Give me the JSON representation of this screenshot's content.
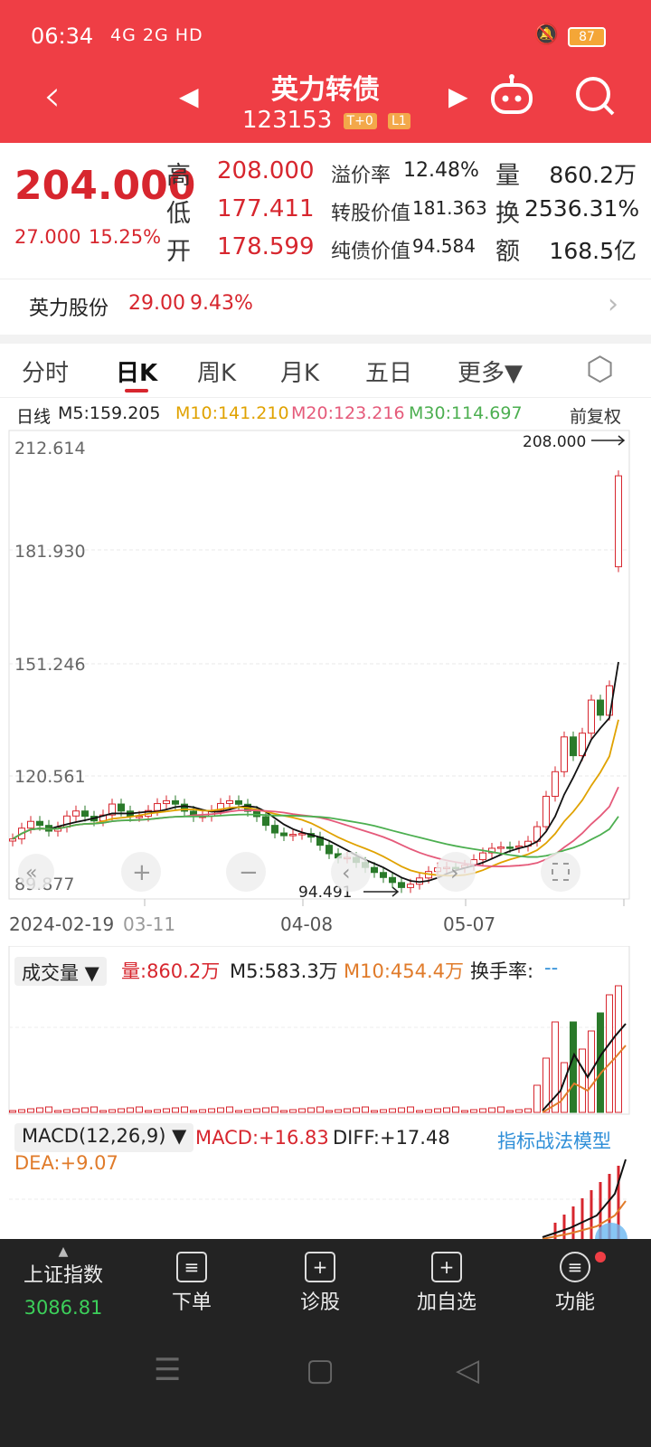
{
  "status": {
    "time": "06:34",
    "signals": "4G 2G HD",
    "battery": "87"
  },
  "header": {
    "title": "英力转债",
    "code": "123153",
    "tag1": "T+0",
    "tag2": "L1"
  },
  "quote": {
    "price": "204.000",
    "change": "27.000",
    "change_pct": "15.25%",
    "high_label": "高",
    "high": "208.000",
    "low_label": "低",
    "low": "177.411",
    "open_label": "开",
    "open": "178.599",
    "premium_label": "溢价率",
    "premium": "12.48%",
    "conv_label": "转股价值",
    "conv": "181.363",
    "bond_label": "纯债价值",
    "bond": "94.584",
    "vol_label": "量",
    "vol": "860.2万",
    "turn_label": "换",
    "turn": "2536.31%",
    "amt_label": "额",
    "amt": "168.5亿"
  },
  "stock": {
    "name": "英力股份",
    "price": "29.00",
    "pct": "9.43%"
  },
  "tabs": [
    "分时",
    "日K",
    "周K",
    "月K",
    "五日",
    "更多▼"
  ],
  "ma_legend": {
    "label": "日线",
    "m5": "M5:159.205",
    "m10": "M10:141.210",
    "m20": "M20:123.216",
    "m30": "M30:114.697",
    "adj": "前复权"
  },
  "price_axis": {
    "labels": [
      "212.614",
      "181.930",
      "151.246",
      "120.561",
      "89.877"
    ],
    "high_mark": "208.000",
    "low_mark": "94.491"
  },
  "x_axis": [
    "2024-02-19",
    "03-11",
    "04-08",
    "05-07"
  ],
  "volume": {
    "select": "成交量 ▼",
    "vol": "量:860.2万",
    "m5": "M5:583.3万",
    "m10": "M10:454.4万",
    "turnover": "换手率:",
    "turnover_val": "--"
  },
  "macd": {
    "select": "MACD(12,26,9) ▼",
    "macd": "MACD:+16.83",
    "diff": "DIFF:+17.48",
    "dea": "DEA:+9.07",
    "link": "指标战法模型"
  },
  "bottom": {
    "index_name": "上证指数",
    "index_val": "3086.81",
    "order": "下单",
    "diagnose": "诊股",
    "add": "加自选",
    "func": "功能"
  },
  "colors": {
    "red": "#d7262e",
    "green": "#2a7a2a",
    "brand": "#ef3e45",
    "m10": "#e0a200",
    "m20": "#e55a7a",
    "m30": "#4caf50"
  },
  "chart_data": {
    "type": "candlestick",
    "ylim": [
      89.877,
      212.614
    ],
    "last_close": 204.0
  }
}
